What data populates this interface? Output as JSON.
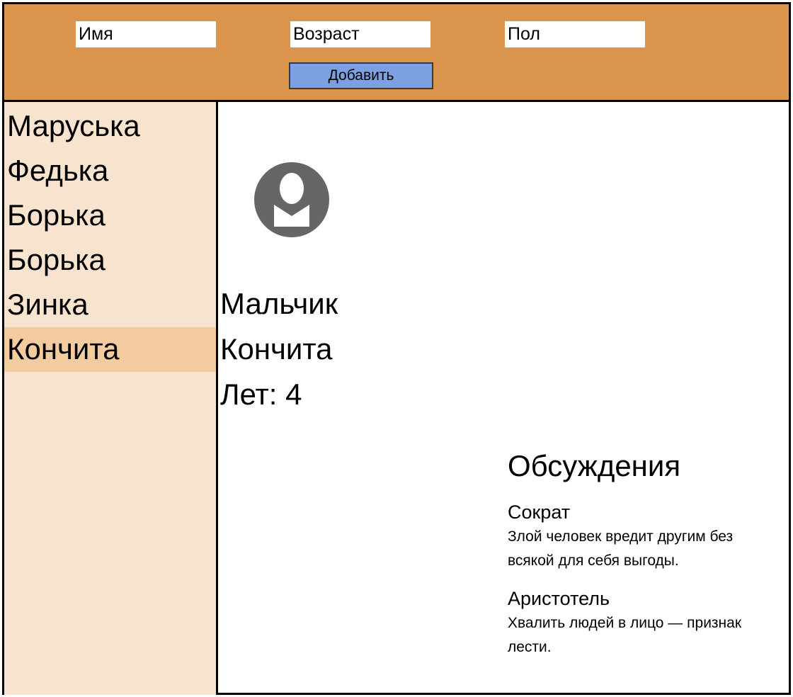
{
  "form": {
    "name_placeholder": "Имя",
    "age_placeholder": "Возраст",
    "gender_placeholder": "Пол",
    "add_label": "Добавить"
  },
  "sidebar": {
    "items": [
      {
        "label": "Маруська",
        "selected": false
      },
      {
        "label": "Федька",
        "selected": false
      },
      {
        "label": "Борька",
        "selected": false
      },
      {
        "label": "Борька",
        "selected": false
      },
      {
        "label": "Зинка",
        "selected": false
      },
      {
        "label": "Кончита",
        "selected": true
      }
    ]
  },
  "profile": {
    "avatar_icon": "user-avatar-icon",
    "gender": "Мальчик",
    "name": "Кончита",
    "age_text": "Лет: 4"
  },
  "discussion": {
    "title": "Обсуждения",
    "comments": [
      {
        "author": "Сократ",
        "text": "Злой человек вредит другим без всякой для себя выгоды."
      },
      {
        "author": "Аристотель",
        "text": "Хвалить людей в лицо — признак лести."
      }
    ]
  },
  "colors": {
    "header_bg": "#db944b",
    "sidebar_bg": "#f8e4ce",
    "sidebar_selected_bg": "#f2cc9e",
    "button_bg": "#7da0e2",
    "avatar": "#666666"
  }
}
